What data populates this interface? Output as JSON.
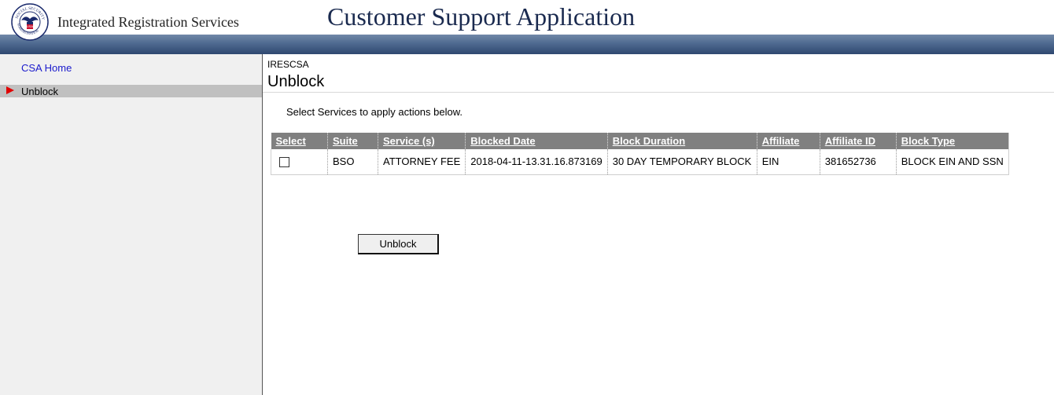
{
  "header": {
    "org_name": "Integrated Registration Services",
    "app_title": "Customer Support Application",
    "logo_top_text": "SOCIAL SECURITY",
    "logo_bottom_text": "ADMINISTRATION",
    "logo_center_text": "USA"
  },
  "sidebar": {
    "home_link": "CSA Home",
    "current_item": "Unblock"
  },
  "main": {
    "breadcrumb": "IRESCSA",
    "page_title": "Unblock",
    "instructions": "Select Services to apply actions below.",
    "table": {
      "headers": [
        "Select",
        "Suite",
        "Service (s)",
        "Blocked Date",
        "Block Duration",
        "Affiliate",
        "Affiliate ID",
        "Block Type"
      ],
      "rows": [
        {
          "selected": false,
          "suite": "BSO",
          "service": "ATTORNEY FEE",
          "blocked_date": "2018-04-11-13.31.16.873169",
          "block_duration": "30 DAY TEMPORARY BLOCK",
          "affiliate": "EIN",
          "affiliate_id": "381652736",
          "block_type": "BLOCK EIN AND SSN"
        }
      ]
    },
    "unblock_button": "Unblock"
  },
  "colors": {
    "banner": "#4f6a90",
    "title": "#1a2a4f",
    "link": "#1a1acc",
    "header_row": "#808080",
    "nav_arrow": "#e00000"
  }
}
